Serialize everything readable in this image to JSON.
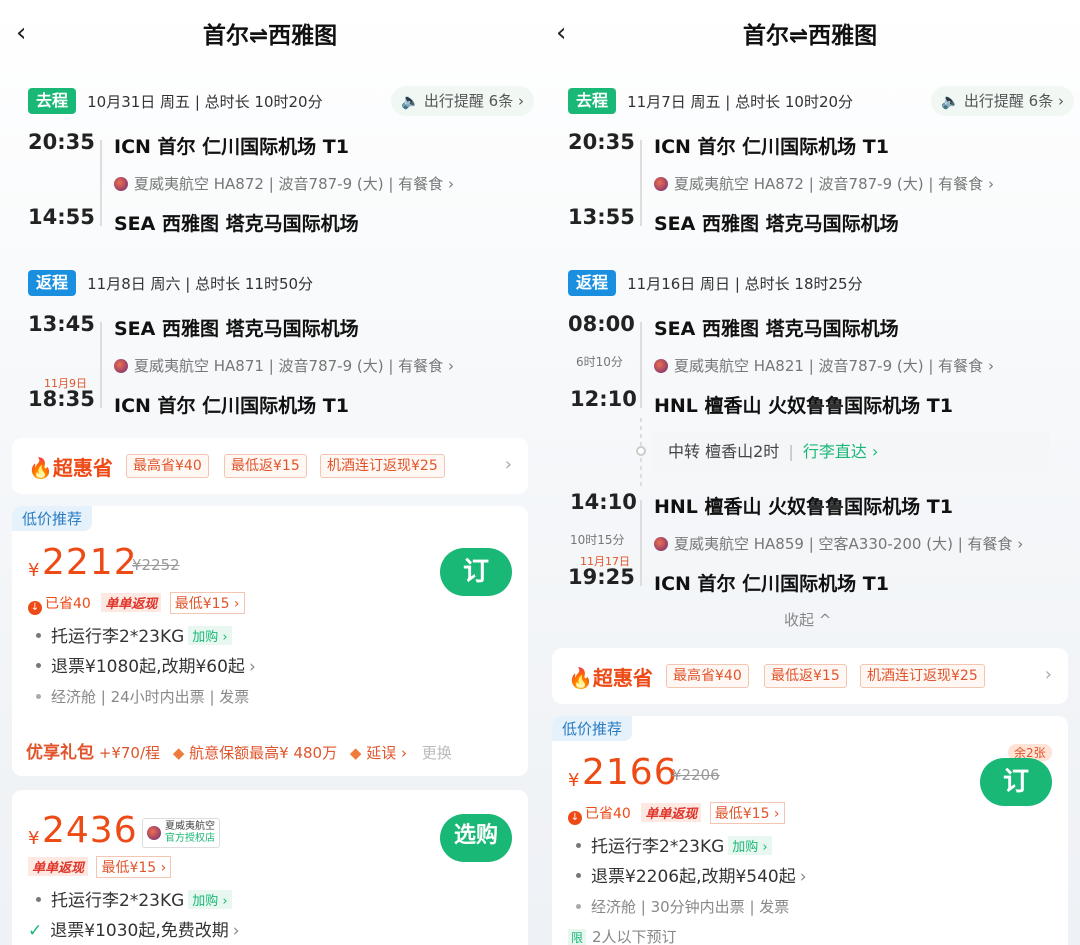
{
  "panels": [
    {
      "title": "首尔⇌西雅图",
      "go": {
        "tag": "去程",
        "info": "10月31日 周五 | 总时长 10时20分",
        "reminder": "出行提醒 6条 ›",
        "dep_time": "20:35",
        "dep_airport": "ICN 首尔 仁川国际机场 T1",
        "airline": "夏威夷航空 HA872 | 波音787-9 (大) | 有餐食 ›",
        "arr_time": "14:55",
        "arr_airport": "SEA 西雅图 塔克马国际机场"
      },
      "ret": {
        "tag": "返程",
        "info": "11月8日 周六 | 总时长 11时50分",
        "dep_time": "13:45",
        "dep_airport": "SEA 西雅图 塔克马国际机场",
        "airline": "夏威夷航空 HA871 | 波音787-9 (大) | 有餐食 ›",
        "arr_date": "11月9日",
        "arr_time": "18:35",
        "arr_airport": "ICN 首尔 仁川国际机场 T1"
      },
      "promo": {
        "logo": "超惠省",
        "tags": [
          "最高省¥40",
          "最低返¥15",
          "机酒连订返现¥25"
        ]
      },
      "card1": {
        "tag": "低价推荐",
        "yen": "¥",
        "price": "2212",
        "old_price": "¥2252",
        "saved": "已省40",
        "dd": "单单返现",
        "low": "最低¥15 ›",
        "btn": "订",
        "luggage": "托运行李2*23KG",
        "addon": "加购 ›",
        "refund": "退票¥1080起,改期¥60起",
        "cabin": "经济舱 | 24小时内出票 | 发票",
        "pkg_name": "优享礼包",
        "pkg_price": "+¥70/程",
        "pkg_ins": "航意保额最高¥ 480万",
        "pkg_delay": "延误 ›",
        "pkg_more": "更换"
      },
      "card2": {
        "yen": "¥",
        "price": "2436",
        "badge_line1": "夏威夷航空",
        "badge_line2": "官方授权店",
        "dd": "单单返现",
        "low": "最低¥15 ›",
        "btn": "选购",
        "luggage": "托运行李2*23KG",
        "addon": "加购 ›",
        "refund": "退票¥1030起,免费改期"
      }
    },
    {
      "title": "首尔⇌西雅图",
      "go": {
        "tag": "去程",
        "info": "11月7日 周五 | 总时长 10时20分",
        "reminder": "出行提醒 6条 ›",
        "dep_time": "20:35",
        "dep_airport": "ICN 首尔 仁川国际机场 T1",
        "airline": "夏威夷航空 HA872 | 波音787-9 (大) | 有餐食 ›",
        "arr_time": "13:55",
        "arr_airport": "SEA 西雅图 塔克马国际机场"
      },
      "ret": {
        "tag": "返程",
        "info": "11月16日 周日 | 总时长 18时25分",
        "dep_time": "08:00",
        "dep_airport": "SEA 西雅图 塔克马国际机场",
        "duration1": "6时10分",
        "airline1": "夏威夷航空 HA821 | 波音787-9 (大) | 有餐食 ›",
        "mid_time": "12:10",
        "mid_airport": "HNL 檀香山 火奴鲁鲁国际机场 T1",
        "transfer": "中转 檀香山2时",
        "transfer_link": "行李直达 ›",
        "mid2_time": "14:10",
        "mid2_airport": "HNL 檀香山 火奴鲁鲁国际机场 T1",
        "duration2": "10时15分",
        "airline2": "夏威夷航空 HA859 | 空客A330-200 (大) | 有餐食 ›",
        "arr_date": "11月17日",
        "arr_time": "19:25",
        "arr_airport": "ICN 首尔 仁川国际机场 T1",
        "collapse": "收起 ^"
      },
      "promo": {
        "logo": "超惠省",
        "tags": [
          "最高省¥40",
          "最低返¥15",
          "机酒连订返现¥25"
        ]
      },
      "card1": {
        "tag": "低价推荐",
        "yen": "¥",
        "price": "2166",
        "old_price": "¥2206",
        "saved": "已省40",
        "dd": "单单返现",
        "low": "最低¥15 ›",
        "btn": "订",
        "remaining": "余2张",
        "luggage": "托运行李2*23KG",
        "addon": "加购 ›",
        "refund": "退票¥2206起,改期¥540起",
        "cabin": "经济舱 | 30分钟内出票 | 发票",
        "limit_tag": "限",
        "limit": "2人以下预订"
      }
    }
  ]
}
